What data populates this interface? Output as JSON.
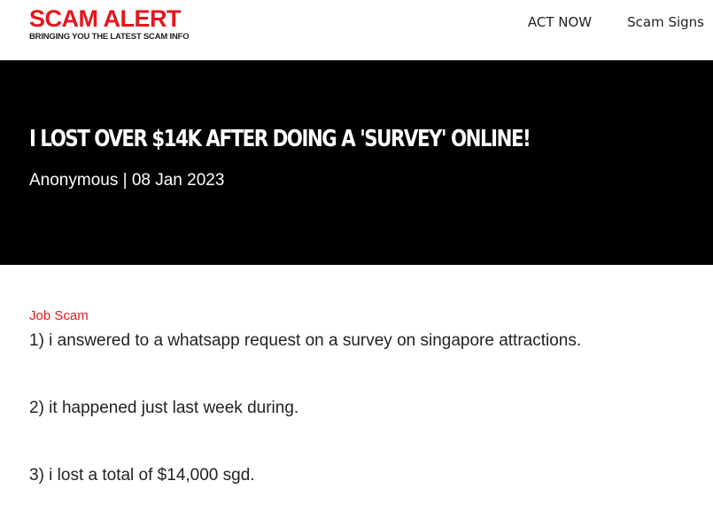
{
  "header": {
    "logo_title": "SCAM ALERT",
    "logo_tagline": "BRINGING YOU THE LATEST SCAM INFO",
    "nav": [
      {
        "label": "ACT NOW"
      },
      {
        "label": "Scam Signs"
      }
    ]
  },
  "hero": {
    "title": "I lost over $14k after doing a 'survey' online!",
    "byline": "Anonymous | 08 Jan 2023"
  },
  "article": {
    "category": "Job Scam",
    "paragraphs": [
      "1) i answered to a whatsapp request on a survey on singapore attractions.",
      "2) it happened just last week during.",
      "3) i lost a total of $14,000 sgd."
    ]
  },
  "colors": {
    "brand_red": "#e3171e",
    "hero_background": "#000000",
    "text": "#222222"
  }
}
